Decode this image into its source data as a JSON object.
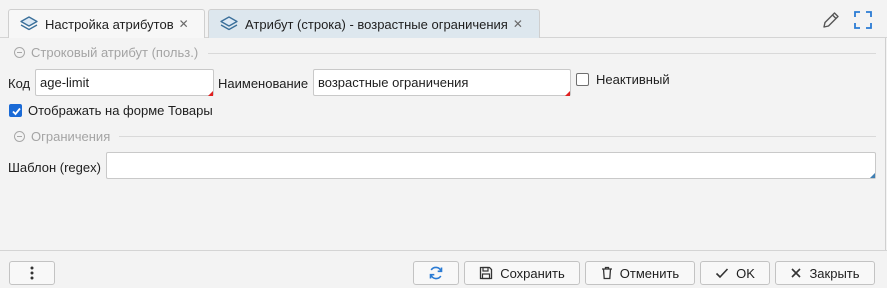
{
  "tabs": [
    {
      "label": "Настройка атрибутов",
      "icon": "layers-icon",
      "active": false
    },
    {
      "label": "Атрибут (строка) - возрастные ограничения",
      "icon": "layers-icon",
      "active": true
    }
  ],
  "toolbar_icons": [
    "edit-icon",
    "expand-icon"
  ],
  "groups": {
    "string_attr": {
      "title": "Строковый атрибут (польз.)"
    },
    "constraints": {
      "title": "Ограничения"
    }
  },
  "form": {
    "code": {
      "label": "Код",
      "value": "age-limit"
    },
    "name": {
      "label": "Наименование",
      "value": "возрастные ограничения"
    },
    "inactive": {
      "label": "Неактивный",
      "checked": false
    },
    "show_on_form": {
      "label": "Отображать на форме Товары",
      "checked": true
    },
    "template": {
      "label": "Шаблон (regex)",
      "value": ""
    }
  },
  "buttons": {
    "more": {
      "icon": "more-vertical-icon"
    },
    "refresh": {
      "icon": "refresh-icon"
    },
    "save": {
      "label": "Сохранить",
      "icon": "save-icon"
    },
    "cancel": {
      "label": "Отменить",
      "icon": "trash-icon"
    },
    "ok": {
      "label": "OK",
      "icon": "check-icon"
    },
    "close": {
      "label": "Закрыть",
      "icon": "close-icon"
    }
  },
  "colors": {
    "accent": "#1a6ad6",
    "active_tab": "#dde7ee",
    "required_marker": "#e02020"
  }
}
